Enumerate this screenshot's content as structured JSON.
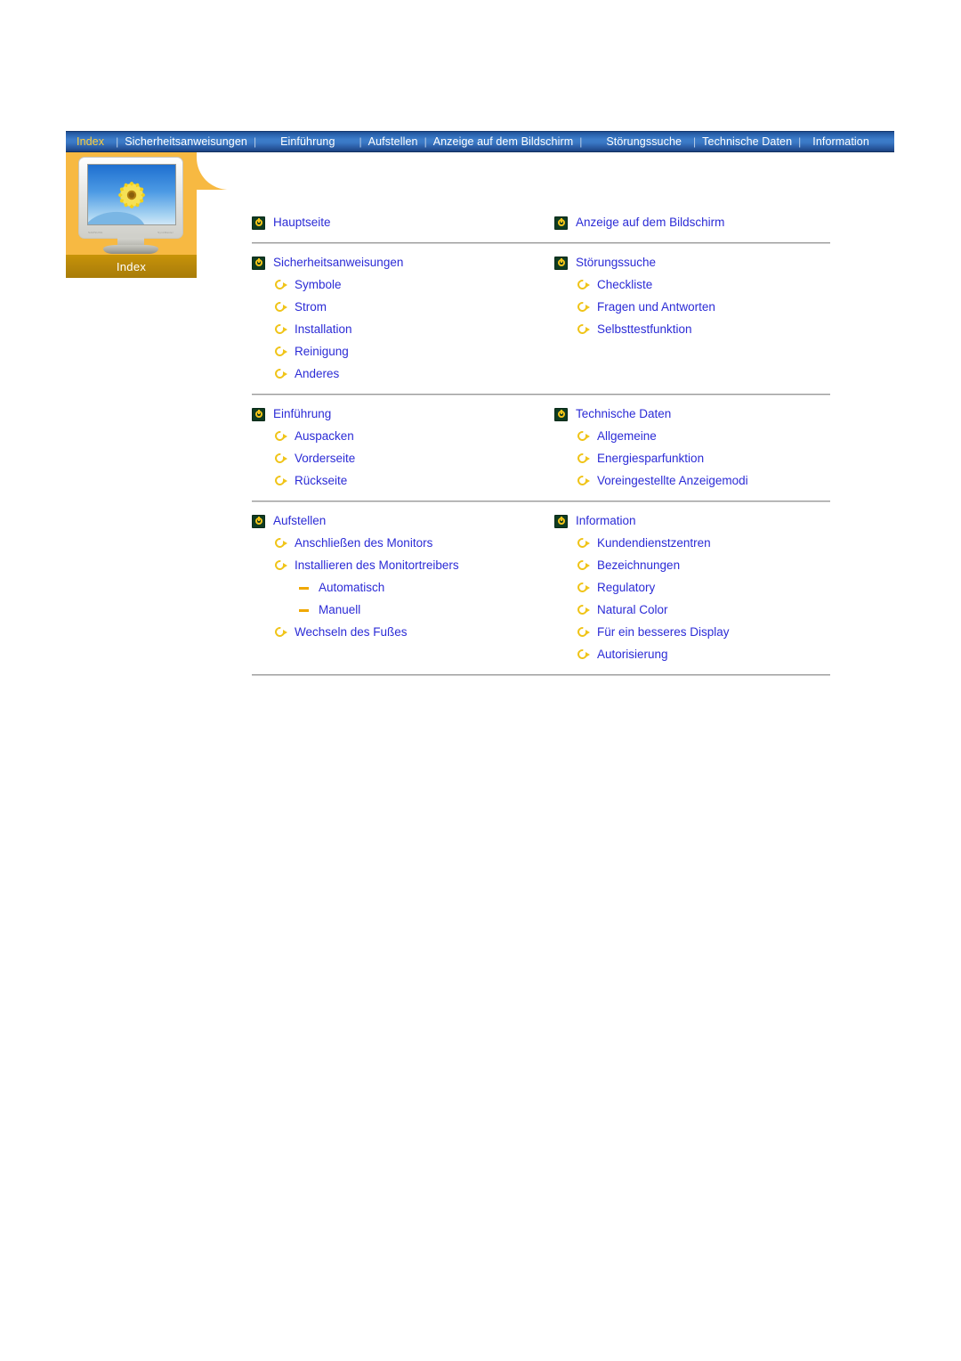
{
  "navbar": {
    "items": [
      {
        "label": "Index",
        "current": true
      },
      {
        "label": "Sicherheitsanweisungen",
        "current": false
      },
      {
        "label": "Einführung",
        "current": false
      },
      {
        "label": "Aufstellen",
        "current": false
      },
      {
        "label": "Anzeige auf dem Bildschirm",
        "current": false
      },
      {
        "label": "Störungssuche",
        "current": false
      },
      {
        "label": "Technische Daten",
        "current": false
      },
      {
        "label": "Information",
        "current": false
      }
    ],
    "separator": "|",
    "background_start": "#1e4f93",
    "background_mid": "#3c7cc9",
    "text_color": "#ffffff",
    "current_color": "#ffcf3b"
  },
  "index_panel": {
    "tab_label": "Index",
    "panel_color": "#f7b942",
    "tab_band_color": "#b7870a",
    "monitor_brand_left": "SAMSUNG",
    "monitor_brand_right": "SyncMaster"
  },
  "content": {
    "link_color": "#2b2bd6",
    "icons": {
      "section": "power-ring-icon",
      "sub": "circular-arrow-icon",
      "subsub": "dash-icon"
    },
    "blocks": [
      {
        "left": {
          "section": "Hauptseite",
          "subs": []
        },
        "right": {
          "section": "Anzeige auf dem Bildschirm",
          "subs": []
        }
      },
      {
        "left": {
          "section": "Sicherheitsanweisungen",
          "subs": [
            {
              "label": "Symbole",
              "children": []
            },
            {
              "label": "Strom",
              "children": []
            },
            {
              "label": "Installation",
              "children": []
            },
            {
              "label": "Reinigung",
              "children": []
            },
            {
              "label": "Anderes",
              "children": []
            }
          ]
        },
        "right": {
          "section": "Störungssuche",
          "subs": [
            {
              "label": "Checkliste",
              "children": []
            },
            {
              "label": "Fragen und Antworten",
              "children": []
            },
            {
              "label": "Selbsttestfunktion",
              "children": []
            }
          ]
        }
      },
      {
        "left": {
          "section": "Einführung",
          "subs": [
            {
              "label": "Auspacken",
              "children": []
            },
            {
              "label": "Vorderseite",
              "children": []
            },
            {
              "label": "Rückseite",
              "children": []
            }
          ]
        },
        "right": {
          "section": "Technische Daten",
          "subs": [
            {
              "label": "Allgemeine",
              "children": []
            },
            {
              "label": "Energiesparfunktion",
              "children": []
            },
            {
              "label": "Voreingestellte Anzeigemodi",
              "children": []
            }
          ]
        }
      },
      {
        "left": {
          "section": "Aufstellen",
          "subs": [
            {
              "label": "Anschließen des Monitors",
              "children": []
            },
            {
              "label": "Installieren des Monitortreibers",
              "children": [
                "Automatisch",
                "Manuell"
              ]
            },
            {
              "label": "Wechseln des Fußes",
              "children": []
            }
          ]
        },
        "right": {
          "section": "Information",
          "subs": [
            {
              "label": "Kundendienstzentren",
              "children": []
            },
            {
              "label": "Bezeichnungen",
              "children": []
            },
            {
              "label": "Regulatory",
              "children": []
            },
            {
              "label": "Natural Color",
              "children": []
            },
            {
              "label": "Für ein besseres Display",
              "children": []
            },
            {
              "label": "Autorisierung",
              "children": []
            }
          ]
        }
      }
    ]
  }
}
